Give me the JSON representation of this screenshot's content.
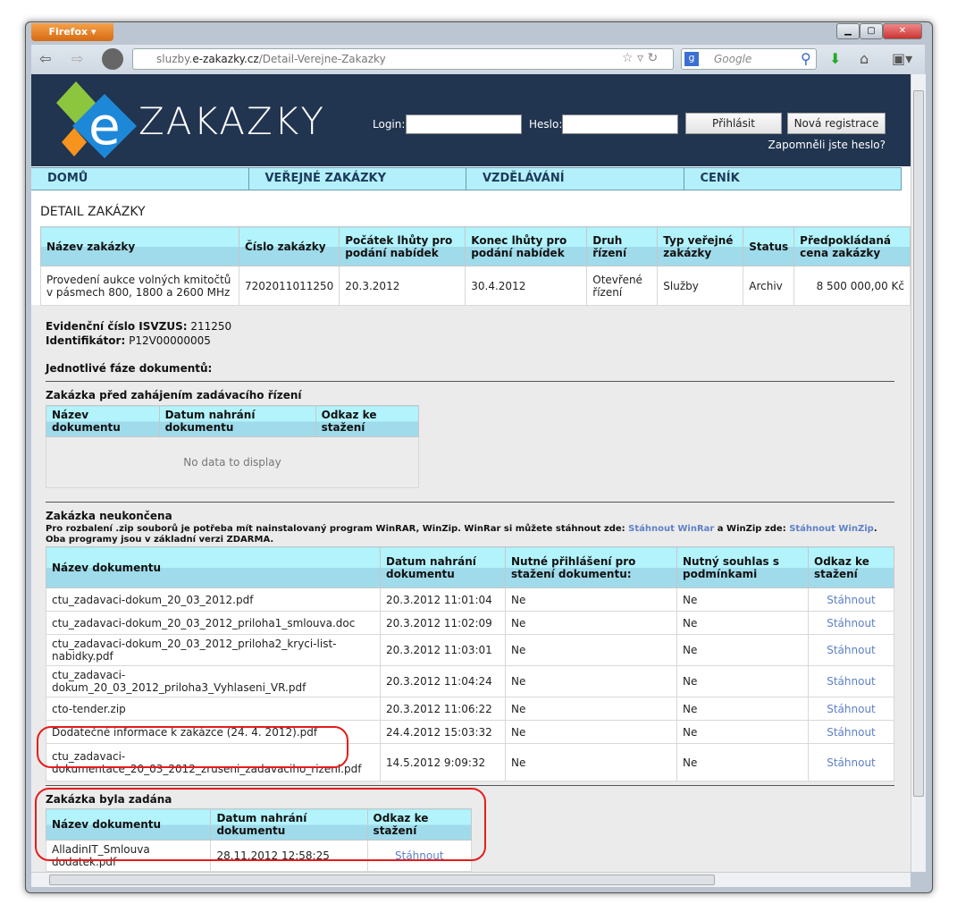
{
  "browser": {
    "menu_label": "Firefox",
    "url_prefix": "sluzby.",
    "url_domain": "e-zakazky.cz",
    "url_path": "/Detail-Verejne-Zakazky",
    "search_placeholder": "Google"
  },
  "header": {
    "brand": "ZAKAZKY",
    "logo_letter": "e",
    "login_label": "Login:",
    "password_label": "Heslo:",
    "login_value": "",
    "password_value": "",
    "login_button": "Přihlásit",
    "register_button": "Nová registrace",
    "forgot_link": "Zapomněli jste heslo?"
  },
  "nav": [
    "DOMŮ",
    "VEŘEJNÉ ZAKÁZKY",
    "VZDĚLÁVÁNÍ",
    "CENÍK"
  ],
  "page_title": "DETAIL ZAKÁZKY",
  "detail_table": {
    "headers": [
      "Název zakázky",
      "Číslo zakázky",
      "Počátek lhůty pro podání nabídek",
      "Konec lhůty pro podání nabídek",
      "Druh řízení",
      "Typ veřejné zakázky",
      "Status",
      "Předpokládaná cena zakázky"
    ],
    "row": [
      "Provedení aukce volných kmitočtů v pásmech 800, 1800 a 2600 MHz",
      "7202011011250",
      "20.3.2012",
      "30.4.2012",
      "Otevřené řízení",
      "Služby",
      "Archiv",
      "8 500 000,00 Kč"
    ]
  },
  "info": {
    "isvzus_label": "Evidenční číslo ISVZUS:",
    "isvzus": "211250",
    "id_label": "Identifikátor:",
    "id": "P12V00000005",
    "phases_title": "Jednotlivé fáze dokumentů:"
  },
  "phase1": {
    "title": "Zakázka před zahájením zadávacího řízení",
    "headers": [
      "Název dokumentu",
      "Datum nahrání dokumentu",
      "Odkaz ke stažení"
    ],
    "empty": "No data to display"
  },
  "phase2": {
    "title": "Zakázka neukončena",
    "note_1": "Pro rozbalení .zip souborů je potřeba mít nainstalovaný program WinRAR, WinZip. WinRar si můžete stáhnout zde: ",
    "link_winrar": "Stáhnout WinRar",
    "note_2": " a WinZip zde: ",
    "link_winzip": "Stáhnout WinZip",
    "note_3": ". Oba programy jsou v základní verzi ZDARMA.",
    "headers": [
      "Název dokumentu",
      "Datum nahrání dokumentu",
      "Nutné přihlášení pro stažení dokumentu:",
      "Nutný souhlas s podmínkami",
      "Odkaz ke stažení"
    ],
    "rows": [
      [
        "ctu_zadavaci-dokum_20_03_2012.pdf",
        "20.3.2012 11:01:04",
        "Ne",
        "Ne",
        "Stáhnout"
      ],
      [
        "ctu_zadavaci-dokum_20_03_2012_priloha1_smlouva.doc",
        "20.3.2012 11:02:09",
        "Ne",
        "Ne",
        "Stáhnout"
      ],
      [
        "ctu_zadavaci-dokum_20_03_2012_priloha2_kryci-list-nabidky.pdf",
        "20.3.2012 11:03:01",
        "Ne",
        "Ne",
        "Stáhnout"
      ],
      [
        "ctu_zadavaci-dokum_20_03_2012_priloha3_Vyhlaseni_VR.pdf",
        "20.3.2012 11:04:24",
        "Ne",
        "Ne",
        "Stáhnout"
      ],
      [
        "cto-tender.zip",
        "20.3.2012 11:06:22",
        "Ne",
        "Ne",
        "Stáhnout"
      ],
      [
        "Dodatečné informace k zakázce (24. 4. 2012).pdf",
        "24.4.2012 15:03:32",
        "Ne",
        "Ne",
        "Stáhnout"
      ],
      [
        "ctu_zadavaci-dokumentace_20_03_2012_zruseni_zadavaciho_rizeni.pdf",
        "14.5.2012 9:09:32",
        "Ne",
        "Ne",
        "Stáhnout"
      ]
    ]
  },
  "phase3": {
    "title": "Zakázka byla zadána",
    "headers": [
      "Název dokumentu",
      "Datum nahrání dokumentu",
      "Odkaz ke stažení"
    ],
    "rows": [
      [
        "AlladinIT_Smlouva dodatek.pdf",
        "28.11.2012 12:58:25",
        "Stáhnout"
      ]
    ]
  },
  "colors": {
    "header_bg": "#213450",
    "nav_bg": "#b3f0fb",
    "link": "#5f80c7",
    "annotation": "#e51c1c"
  }
}
